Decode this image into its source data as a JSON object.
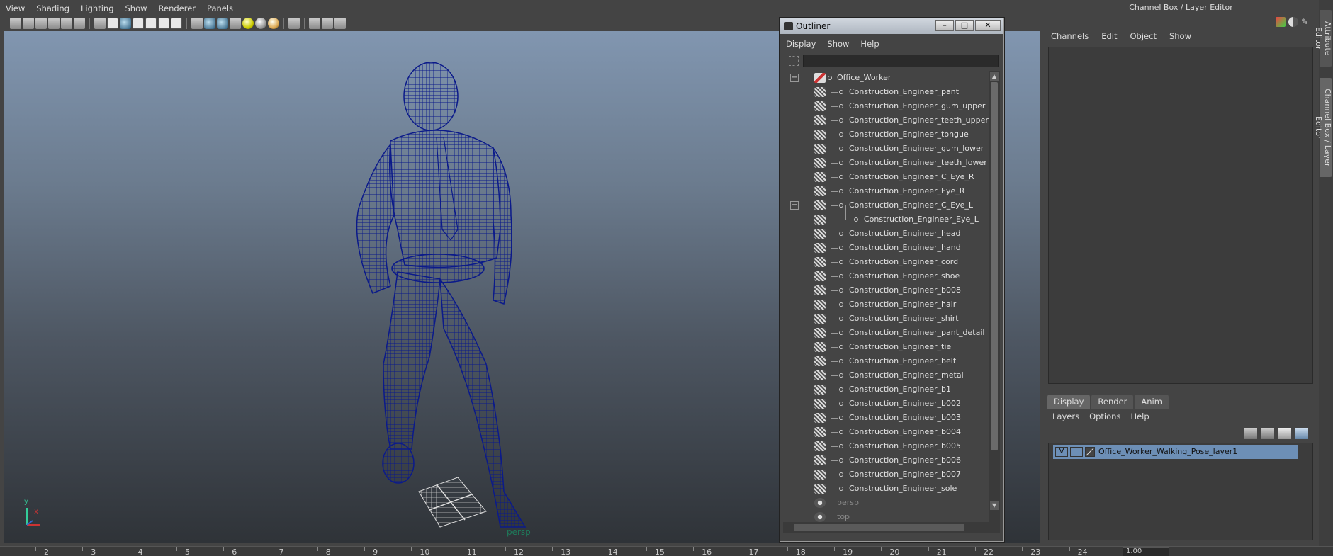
{
  "viewport": {
    "menus": [
      "View",
      "Shading",
      "Lighting",
      "Show",
      "Renderer",
      "Panels"
    ],
    "camera_label": "persp",
    "axis_labels": {
      "x": "x",
      "y": "y"
    }
  },
  "timeline": {
    "ticks": [
      "2",
      "3",
      "4",
      "5",
      "6",
      "7",
      "8",
      "9",
      "10",
      "11",
      "12",
      "13",
      "14",
      "15",
      "16",
      "17",
      "18",
      "19",
      "20",
      "21",
      "22",
      "23",
      "24"
    ],
    "field_value": "1.00"
  },
  "outliner": {
    "title": "Outliner",
    "menus": [
      "Display",
      "Show",
      "Help"
    ],
    "filter_value": "",
    "root": "Office_Worker",
    "children": [
      "Construction_Engineer_pant",
      "Construction_Engineer_gum_upper",
      "Construction_Engineer_teeth_upper",
      "Construction_Engineer_tongue",
      "Construction_Engineer_gum_lower",
      "Construction_Engineer_teeth_lower",
      "Construction_Engineer_C_Eye_R",
      "Construction_Engineer_Eye_R",
      "Construction_Engineer_C_Eye_L",
      "Construction_Engineer_Eye_L",
      "Construction_Engineer_head",
      "Construction_Engineer_hand",
      "Construction_Engineer_cord",
      "Construction_Engineer_shoe",
      "Construction_Engineer_b008",
      "Construction_Engineer_hair",
      "Construction_Engineer_shirt",
      "Construction_Engineer_pant_detail",
      "Construction_Engineer_tie",
      "Construction_Engineer_belt",
      "Construction_Engineer_metal",
      "Construction_Engineer_b1",
      "Construction_Engineer_b002",
      "Construction_Engineer_b003",
      "Construction_Engineer_b004",
      "Construction_Engineer_b005",
      "Construction_Engineer_b006",
      "Construction_Engineer_b007",
      "Construction_Engineer_sole"
    ],
    "cameras": [
      "persp",
      "top"
    ]
  },
  "channel_box": {
    "title": "Channel Box / Layer Editor",
    "menus": [
      "Channels",
      "Edit",
      "Object",
      "Show"
    ]
  },
  "layer_editor": {
    "tabs": [
      "Display",
      "Render",
      "Anim"
    ],
    "active_tab": "Display",
    "menus": [
      "Layers",
      "Options",
      "Help"
    ],
    "layer": {
      "visible": "V",
      "name": "Office_Worker_Walking_Pose_layer1"
    }
  },
  "side_tabs": [
    "Attribute Editor",
    "Channel Box / Layer Editor"
  ],
  "colors": {
    "wireframe": "#0b1a8a",
    "layer_highlight": "#6d8fb6"
  }
}
